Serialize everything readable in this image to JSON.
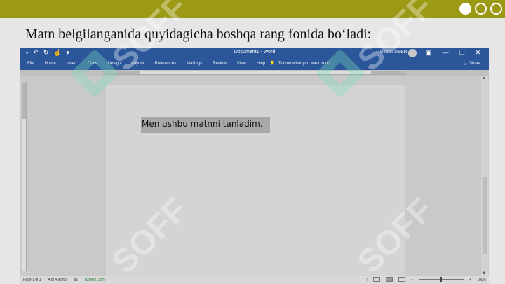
{
  "slide": {
    "title": "Matn belgilanganida quyidagicha boshqa rang fonida bo‘ladi:",
    "accent_color": "#9c9a14"
  },
  "titlebar": {
    "document_title": "Document1 - Word",
    "user": "Uzbek USER",
    "qat_icons": [
      "save-icon",
      "undo-icon",
      "redo-icon",
      "touch-icon"
    ],
    "window_controls": [
      "ribbon-display-icon",
      "minimize-icon",
      "restore-icon",
      "close-icon"
    ]
  },
  "ribbon": {
    "tabs": [
      "File",
      "Home",
      "Insert",
      "Draw",
      "Design",
      "Layout",
      "References",
      "Mailings",
      "Review",
      "View",
      "Help"
    ],
    "tell_me": "Tell me what you want to do",
    "share": "Share",
    "color": "#2b579a"
  },
  "document": {
    "selected_text": "Men ushbu matnni tanladim.",
    "selection_color": "#a8a8a8"
  },
  "statusbar": {
    "page": "Page 1 of 1",
    "words": "4 of 4 words",
    "language": "Uzbek (Latin)",
    "zoom": "100%"
  },
  "watermark": {
    "text": "SOFF"
  }
}
